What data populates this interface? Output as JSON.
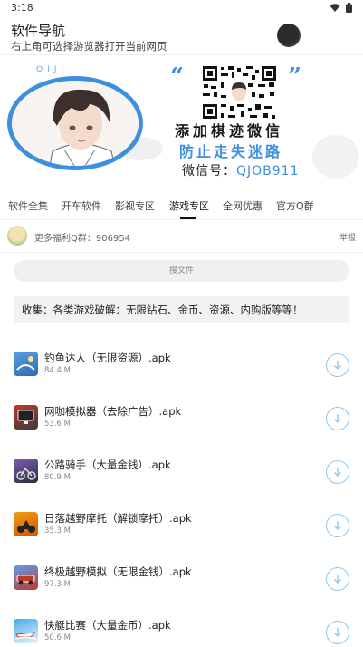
{
  "status_bar": {
    "time": "3:18",
    "wifi_icon": "wifi-icon",
    "battery_icon": "battery-icon"
  },
  "header": {
    "title": "软件导航",
    "subtitle": "右上角可选择游览器打开当前网页",
    "menu_icon": "menu-dot-icon"
  },
  "banner": {
    "qiji": "QIJI",
    "quote_left": "“",
    "quote_right": "”",
    "line1": "添加棋迹微信",
    "line2": "防止走失迷路",
    "line3_label": "微信号：",
    "line3_value": "QJOB911"
  },
  "tabs": [
    {
      "label": "软件全集",
      "active": false
    },
    {
      "label": "开车软件",
      "active": false
    },
    {
      "label": "影视专区",
      "active": false
    },
    {
      "label": "游戏专区",
      "active": true
    },
    {
      "label": "全网优惠",
      "active": false
    },
    {
      "label": "官方Q群",
      "active": false
    }
  ],
  "qq_group": {
    "label": "更多福利Q群：906954",
    "report": "举报"
  },
  "search": {
    "placeholder": "搜文件"
  },
  "notice": "收集：各类游戏破解：无限钻石、金币、资源、内购版等等！",
  "files": [
    {
      "name": "钓鱼达人（无限资源）.apk",
      "size": "84.4 M",
      "icon": "fishing-game-icon",
      "colors": [
        "#5b9fe0",
        "#2d6bb5"
      ]
    },
    {
      "name": "网咖模拟器（去除广告）.apk",
      "size": "53.6 M",
      "icon": "netcafe-game-icon",
      "colors": [
        "#c0392b",
        "#3b3b3b"
      ]
    },
    {
      "name": "公路骑手（大量金钱）.apk",
      "size": "80.9 M",
      "icon": "road-rider-game-icon",
      "colors": [
        "#7b5fb5",
        "#2c2c3e"
      ]
    },
    {
      "name": "日落越野摩托（解锁摩托）.apk",
      "size": "35.3 M",
      "icon": "sunset-moto-game-icon",
      "colors": [
        "#f39c12",
        "#d35400"
      ]
    },
    {
      "name": "终极越野模拟（无限金钱）.apk",
      "size": "97.3 M",
      "icon": "offroad-sim-game-icon",
      "colors": [
        "#5d9cec",
        "#c0392b"
      ]
    },
    {
      "name": "快艇比赛（大量金币）.apk",
      "size": "50.6 M",
      "icon": "speedboat-game-icon",
      "colors": [
        "#48a9e6",
        "#e8f4fb"
      ]
    }
  ]
}
